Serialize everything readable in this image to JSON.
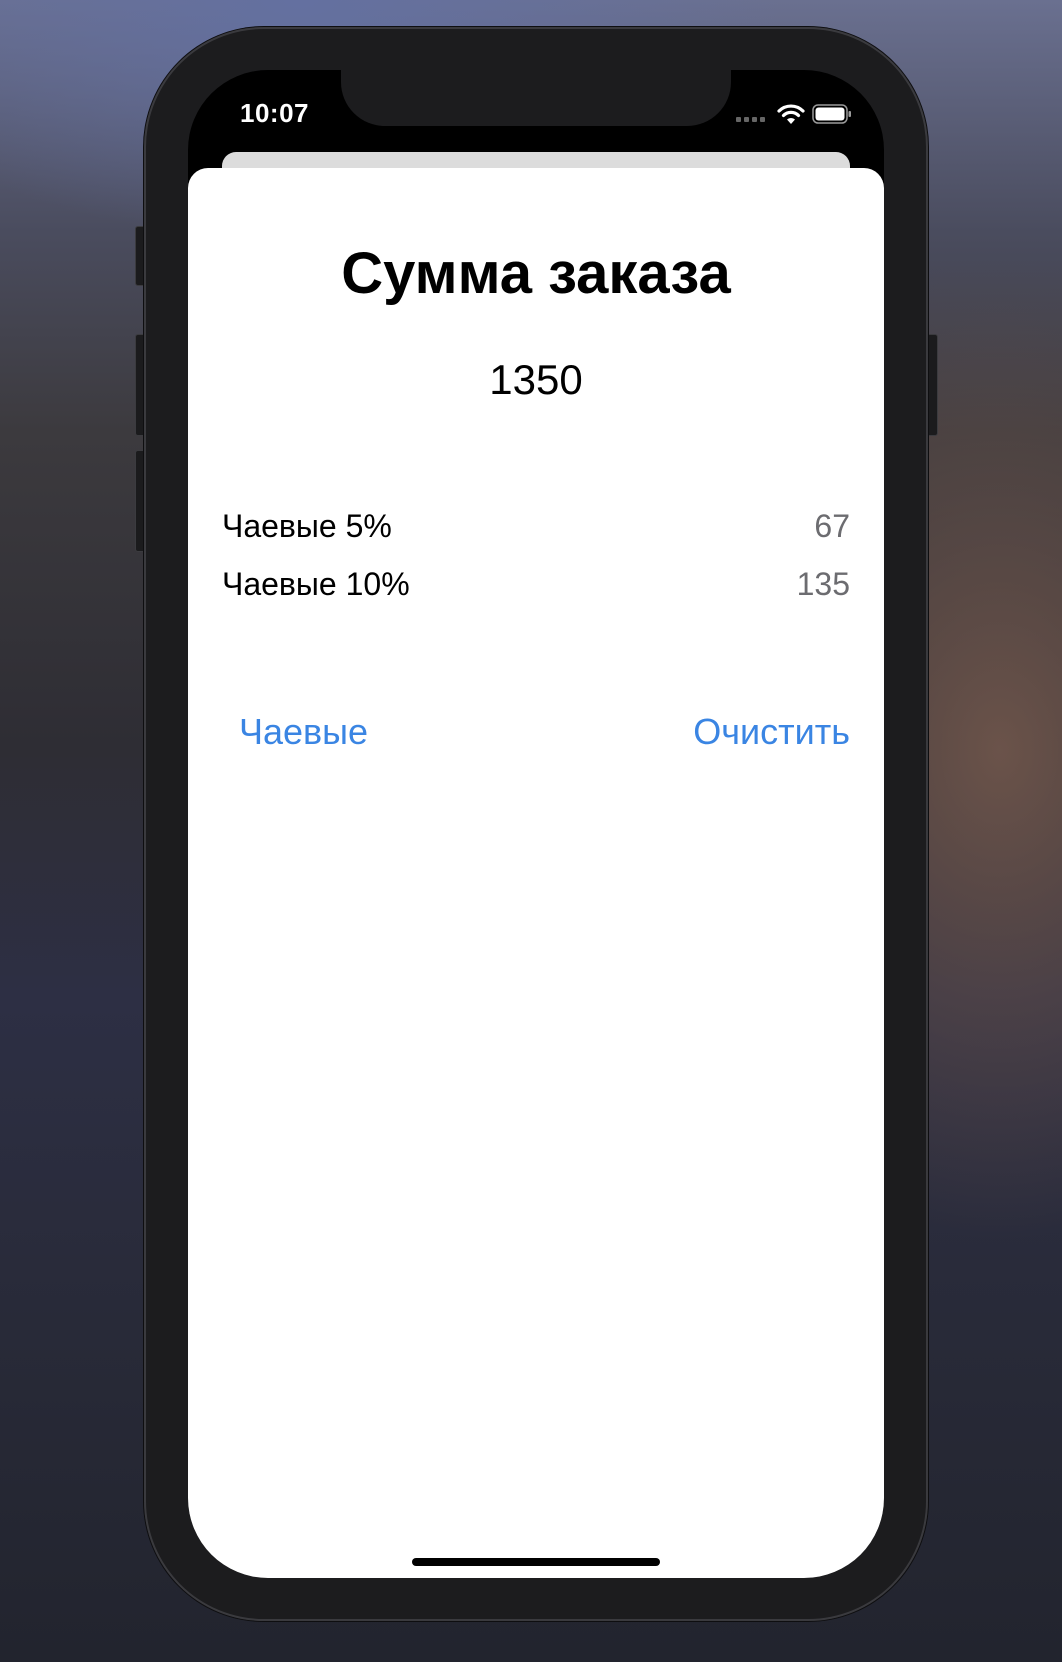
{
  "status_bar": {
    "time": "10:07"
  },
  "sheet": {
    "title": "Сумма заказа",
    "amount": "1350",
    "tips": [
      {
        "label": "Чаевые 5%",
        "value": "67"
      },
      {
        "label": "Чаевые 10%",
        "value": "135"
      }
    ],
    "actions": {
      "tips_label": "Чаевые",
      "clear_label": "Очистить"
    }
  },
  "colors": {
    "accent": "#3a85e3",
    "secondary_text": "#6c6c70",
    "sheet_background": "#ffffff"
  },
  "icons": [
    "signal-icon",
    "wifi-icon",
    "battery-icon"
  ]
}
